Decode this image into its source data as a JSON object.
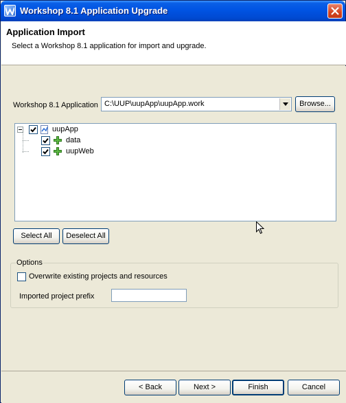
{
  "window": {
    "title": "Workshop 8.1 Application Upgrade"
  },
  "header": {
    "title": "Application Import",
    "description": "Select a Workshop 8.1 application for import and upgrade."
  },
  "application": {
    "label": "Workshop 8.1 Application",
    "path": "C:\\UUP\\uupApp\\uupApp.work",
    "browse_label": "Browse..."
  },
  "tree": {
    "root": {
      "label": "uupApp",
      "checked": true
    },
    "children": [
      {
        "label": "data",
        "checked": true
      },
      {
        "label": "uupWeb",
        "checked": true
      }
    ]
  },
  "selection": {
    "select_all_label": "Select All",
    "deselect_all_label": "Deselect All"
  },
  "options": {
    "legend": "Options",
    "overwrite_label": "Overwrite existing projects and resources",
    "overwrite_checked": false,
    "prefix_label": "Imported project prefix",
    "prefix_value": ""
  },
  "footer": {
    "back_label": "< Back",
    "next_label": "Next >",
    "finish_label": "Finish",
    "cancel_label": "Cancel"
  },
  "icons": {
    "app": "workshop-app-icon",
    "close": "close-icon",
    "project": "project-icon",
    "folder_add": "plus-folder-icon"
  }
}
